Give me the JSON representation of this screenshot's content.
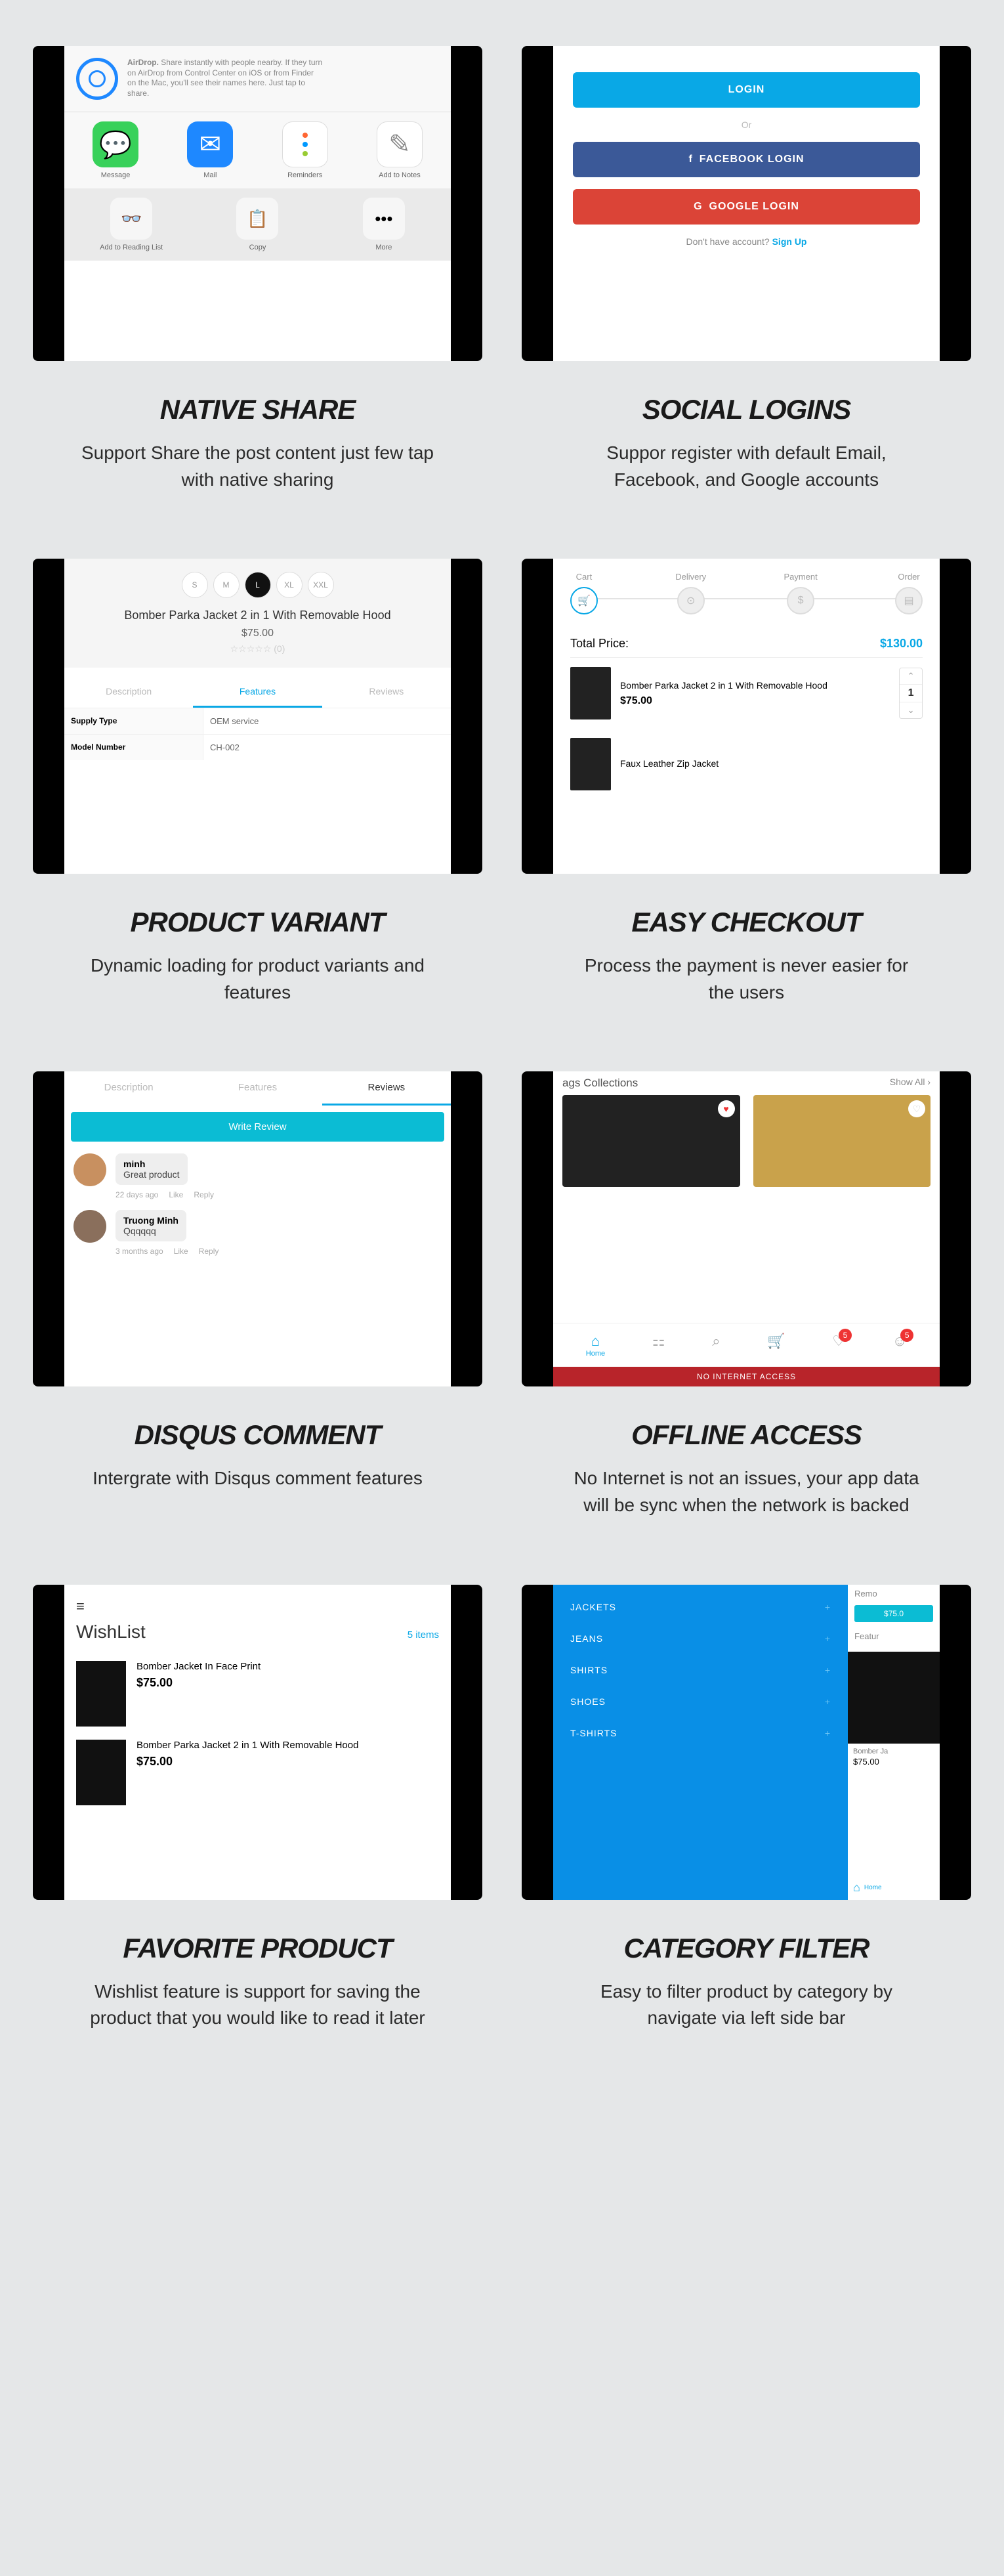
{
  "cards": {
    "native_share": {
      "title": "NATIVE SHARE",
      "desc": "Support Share the post content just few tap with native sharing",
      "airdrop_title": "AirDrop.",
      "airdrop_text": "Share instantly with people nearby. If they turn on AirDrop from Control Center on iOS or from Finder on the Mac, you'll see their names here. Just tap to share.",
      "apps": [
        "Message",
        "Mail",
        "Reminders",
        "Add to Notes"
      ],
      "actions": [
        "Add to Reading List",
        "Copy",
        "More"
      ]
    },
    "social_logins": {
      "title": "SOCIAL LOGINS",
      "desc": "Suppor register with default Email, Facebook, and Google accounts",
      "login": "LOGIN",
      "or": "Or",
      "fb": "FACEBOOK LOGIN",
      "gg": "GOOGLE LOGIN",
      "no_account": "Don't have account?",
      "signup": "Sign Up"
    },
    "product_variant": {
      "title": "PRODUCT VARIANT",
      "desc": "Dynamic loading for product variants and features",
      "sizes": [
        "S",
        "M",
        "L",
        "XL",
        "XXL"
      ],
      "active_size": "L",
      "product": "Bomber Parka Jacket 2 in 1 With Removable Hood",
      "price": "$75.00",
      "reviews": "(0)",
      "tabs": [
        "Description",
        "Features",
        "Reviews"
      ],
      "active_tab": "Features",
      "rows": [
        {
          "k": "Supply Type",
          "v": "OEM service"
        },
        {
          "k": "Model Number",
          "v": "CH-002"
        }
      ]
    },
    "easy_checkout": {
      "title": "EASY CHECKOUT",
      "desc": "Process the payment is never easier for the users",
      "steps": [
        "Cart",
        "Delivery",
        "Payment",
        "Order"
      ],
      "total_label": "Total Price:",
      "total": "$130.00",
      "items": [
        {
          "name": "Bomber Parka Jacket 2 in 1 With Removable Hood",
          "price": "$75.00",
          "qty": "1"
        },
        {
          "name": "Faux Leather Zip Jacket",
          "price": "",
          "qty": ""
        }
      ]
    },
    "disqus": {
      "title": "DISQUS COMMENT",
      "desc": "Intergrate with Disqus comment features",
      "tabs": [
        "Description",
        "Features",
        "Reviews"
      ],
      "write": "Write Review",
      "comments": [
        {
          "user": "minh",
          "text": "Great product",
          "time": "22 days ago",
          "like": "Like",
          "reply": "Reply"
        },
        {
          "user": "Truong Minh",
          "text": "Qqqqqq",
          "time": "3 months ago",
          "like": "Like",
          "reply": "Reply"
        }
      ]
    },
    "offline": {
      "title": "OFFLINE ACCESS",
      "desc": "No Internet is not an issues, your app data will be sync when the network is backed",
      "heading": "ags Collections",
      "show_all": "Show All",
      "home": "Home",
      "badge": "5",
      "banner": "NO INTERNET ACCESS"
    },
    "favorite": {
      "title": "FAVORITE PRODUCT",
      "desc": "Wishlist feature is support for saving the product that you would like to read it later",
      "heading": "WishList",
      "count": "5 items",
      "items": [
        {
          "name": "Bomber Jacket In Face Print",
          "price": "$75.00"
        },
        {
          "name": "Bomber Parka Jacket 2 in 1 With Removable Hood",
          "price": "$75.00"
        }
      ]
    },
    "category": {
      "title": "CATEGORY FILTER",
      "desc": "Easy to filter product by category by navigate via left side bar",
      "menu": [
        "JACKETS",
        "JEANS",
        "SHIRTS",
        "SHOES",
        "T-SHIRTS"
      ],
      "crumb": "Remo",
      "pill": "$75.0",
      "tab": "Featur",
      "pname": "Bomber Ja",
      "pprice": "$75.00",
      "home": "Home"
    }
  }
}
